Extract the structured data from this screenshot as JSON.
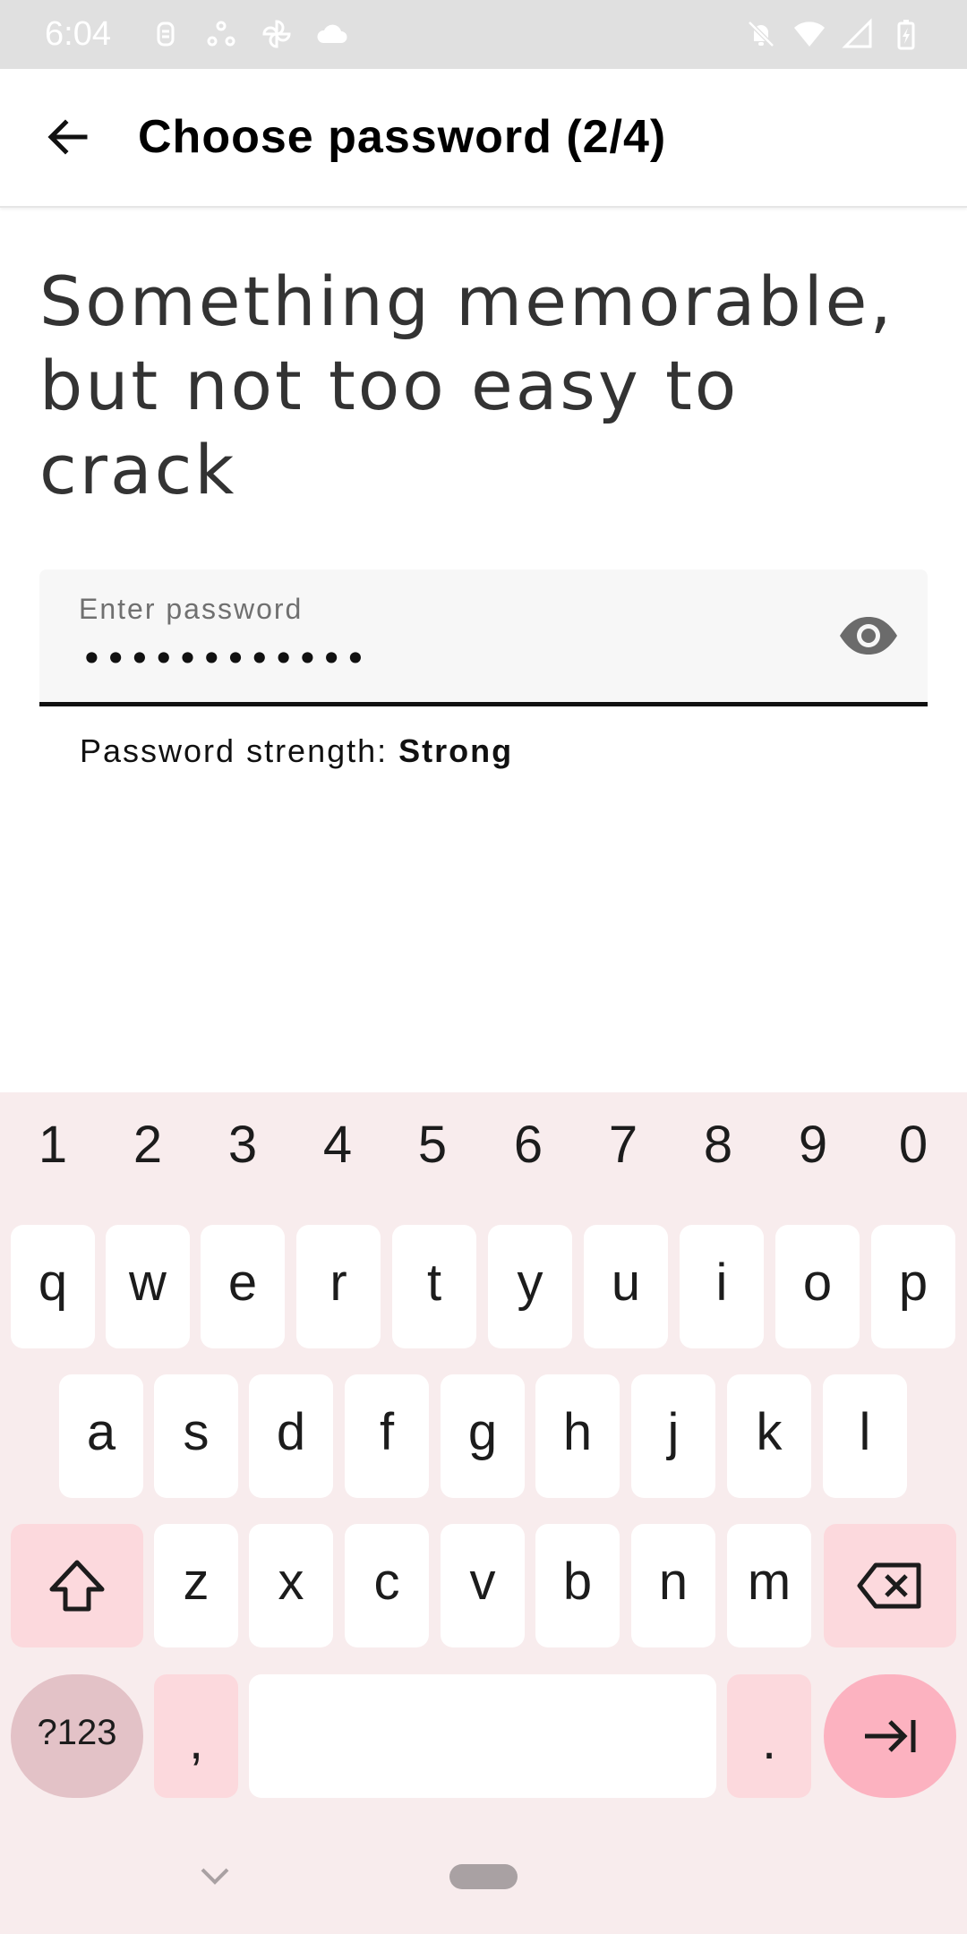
{
  "status_bar": {
    "time": "6:04",
    "left_icons": [
      "notification-icon",
      "sync-icon",
      "pinwheel-icon",
      "cloud-icon"
    ],
    "right_icons": [
      "bell-off-icon",
      "wifi-icon",
      "signal-icon",
      "battery-charging-icon"
    ]
  },
  "app_bar": {
    "title": "Choose password (2/4)",
    "back_icon": "back-arrow-icon"
  },
  "main": {
    "heading": "Something memorable, but not too easy to crack",
    "password_field": {
      "label": "Enter password",
      "value": "••••••••••••",
      "toggle_icon": "eye-icon"
    },
    "strength_label": "Password strength:",
    "strength_value": "Strong"
  },
  "keyboard": {
    "numbers": [
      "1",
      "2",
      "3",
      "4",
      "5",
      "6",
      "7",
      "8",
      "9",
      "0"
    ],
    "row1": [
      "q",
      "w",
      "e",
      "r",
      "t",
      "y",
      "u",
      "i",
      "o",
      "p"
    ],
    "row2": [
      "a",
      "s",
      "d",
      "f",
      "g",
      "h",
      "j",
      "k",
      "l"
    ],
    "row3": [
      "z",
      "x",
      "c",
      "v",
      "b",
      "n",
      "m"
    ],
    "symbols_key": "?123",
    "comma_key": ",",
    "period_key": ".",
    "shift_icon": "shift-icon",
    "backspace_icon": "backspace-icon",
    "enter_icon": "tab-next-icon",
    "hide_icon": "chevron-down-icon"
  },
  "colors": {
    "status_bar_bg": "#e0e0e0",
    "keyboard_bg": "#f8eced",
    "key_bg": "#ffffff",
    "accent_key_bg": "#fcd9dd",
    "enter_key_bg": "#fcb2c0",
    "symbols_key_bg": "#e3c2c7"
  }
}
